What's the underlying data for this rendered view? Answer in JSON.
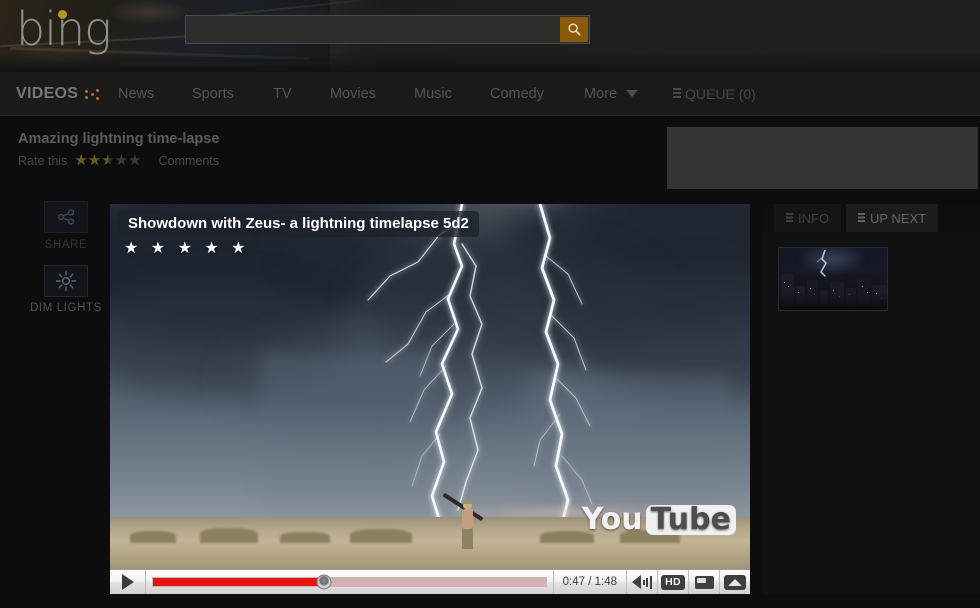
{
  "header": {
    "logo_text": "bing",
    "logo_dot_color": "#d6a92c",
    "search": {
      "value": "",
      "placeholder": "",
      "button_icon": "search-icon",
      "button_color": "#8a5a0b"
    }
  },
  "nav": {
    "brand": "VIDEOS",
    "brand_dots_icon": "bing-dots-icon",
    "items": [
      {
        "label": "News"
      },
      {
        "label": "Sports"
      },
      {
        "label": "TV"
      },
      {
        "label": "Movies"
      },
      {
        "label": "Music"
      },
      {
        "label": "Comedy"
      },
      {
        "label": "More"
      }
    ],
    "queue": {
      "label": "QUEUE (0)",
      "count": 0,
      "icon": "list-icon"
    }
  },
  "page": {
    "video_title": "Amazing lightning time-lapse",
    "rate_label": "Rate this",
    "rating": 2.5,
    "rating_max": 5,
    "rating_stars_filled": "★★★★★",
    "rating_stars_empty": "★★★★★",
    "comments_label": "Comments"
  },
  "rail": {
    "share": {
      "label": "SHARE",
      "icon": "share-icon"
    },
    "dim_lights": {
      "label": "DIM LIGHTS",
      "icon": "brightness-icon"
    }
  },
  "player": {
    "overlay_title": "Showdown with Zeus- a lightning timelapse 5d2",
    "overlay_stars": "★ ★ ★ ★ ★",
    "overlay_star_count": 5,
    "watermark": {
      "you": "You",
      "tube": "Tube"
    },
    "controls": {
      "play_icon": "play-icon",
      "time_display": "0:47 / 1:48",
      "current_time": "0:47",
      "duration": "1:48",
      "progress_percent": 43.5,
      "volume_icon": "volume-icon",
      "hd_label": "HD",
      "captions_icon": "captions-icon",
      "expand_icon": "expand-up-icon",
      "progress_color": "#e8150f"
    }
  },
  "side_panel": {
    "tabs": [
      {
        "label": "INFO",
        "icon": "list-icon",
        "active": false
      },
      {
        "label": "UP NEXT",
        "icon": "list-icon",
        "active": true
      }
    ],
    "thumbnail": {
      "name": "city-lightning-thumbnail"
    }
  },
  "ad": {
    "name": "ad-placeholder",
    "color": "#333333"
  }
}
